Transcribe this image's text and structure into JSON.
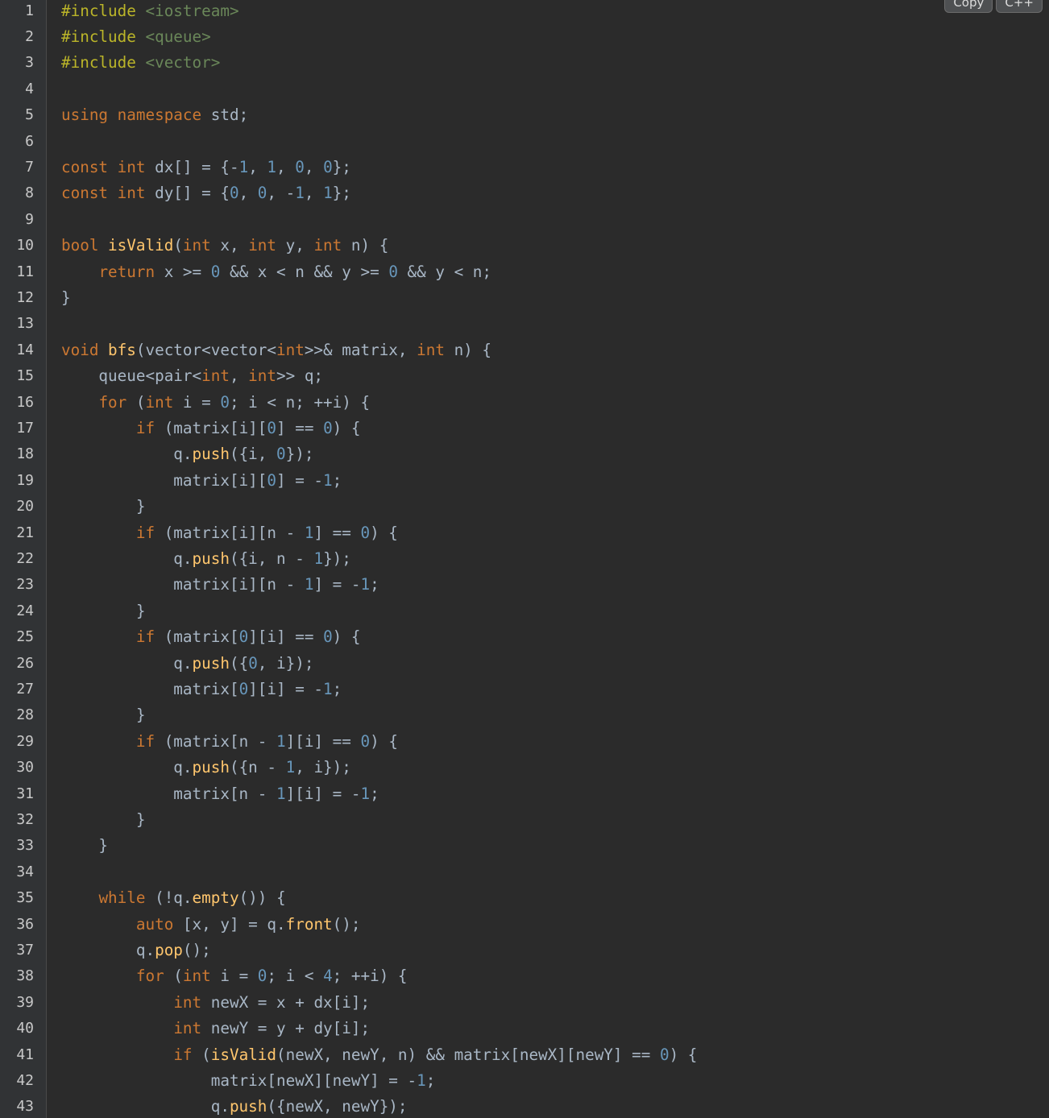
{
  "toolbar": {
    "copy_label": "Copy",
    "language_label": "C++"
  },
  "colors": {
    "background": "#2b2b2b",
    "gutter": "#313335",
    "keyword": "#cc7832",
    "number": "#6897bb",
    "string": "#6a8759",
    "function": "#ffc66d",
    "plain": "#a9b7c6",
    "preprocessor": "#bbb529"
  },
  "lines": [
    {
      "n": "1",
      "tokens": [
        [
          "pp",
          "#include "
        ],
        [
          "hdr",
          "<iostream>"
        ]
      ]
    },
    {
      "n": "2",
      "tokens": [
        [
          "pp",
          "#include "
        ],
        [
          "hdr",
          "<queue>"
        ]
      ]
    },
    {
      "n": "3",
      "tokens": [
        [
          "pp",
          "#include "
        ],
        [
          "hdr",
          "<vector>"
        ]
      ]
    },
    {
      "n": "4",
      "tokens": []
    },
    {
      "n": "5",
      "tokens": [
        [
          "kw",
          "using"
        ],
        [
          "plain",
          " "
        ],
        [
          "kw",
          "namespace"
        ],
        [
          "plain",
          " std;"
        ]
      ]
    },
    {
      "n": "6",
      "tokens": []
    },
    {
      "n": "7",
      "tokens": [
        [
          "kw",
          "const"
        ],
        [
          "plain",
          " "
        ],
        [
          "kw",
          "int"
        ],
        [
          "plain",
          " dx[] = {-"
        ],
        [
          "num",
          "1"
        ],
        [
          "plain",
          ", "
        ],
        [
          "num",
          "1"
        ],
        [
          "plain",
          ", "
        ],
        [
          "num",
          "0"
        ],
        [
          "plain",
          ", "
        ],
        [
          "num",
          "0"
        ],
        [
          "plain",
          "};"
        ]
      ]
    },
    {
      "n": "8",
      "tokens": [
        [
          "kw",
          "const"
        ],
        [
          "plain",
          " "
        ],
        [
          "kw",
          "int"
        ],
        [
          "plain",
          " dy[] = {"
        ],
        [
          "num",
          "0"
        ],
        [
          "plain",
          ", "
        ],
        [
          "num",
          "0"
        ],
        [
          "plain",
          ", -"
        ],
        [
          "num",
          "1"
        ],
        [
          "plain",
          ", "
        ],
        [
          "num",
          "1"
        ],
        [
          "plain",
          "};"
        ]
      ]
    },
    {
      "n": "9",
      "tokens": []
    },
    {
      "n": "10",
      "tokens": [
        [
          "kw",
          "bool"
        ],
        [
          "plain",
          " "
        ],
        [
          "fn",
          "isValid"
        ],
        [
          "plain",
          "("
        ],
        [
          "kw",
          "int"
        ],
        [
          "plain",
          " x, "
        ],
        [
          "kw",
          "int"
        ],
        [
          "plain",
          " y, "
        ],
        [
          "kw",
          "int"
        ],
        [
          "plain",
          " n) {"
        ]
      ]
    },
    {
      "n": "11",
      "tokens": [
        [
          "plain",
          "    "
        ],
        [
          "kw",
          "return"
        ],
        [
          "plain",
          " x >= "
        ],
        [
          "num",
          "0"
        ],
        [
          "plain",
          " && x < n && y >= "
        ],
        [
          "num",
          "0"
        ],
        [
          "plain",
          " && y < n;"
        ]
      ]
    },
    {
      "n": "12",
      "tokens": [
        [
          "plain",
          "}"
        ]
      ]
    },
    {
      "n": "13",
      "tokens": []
    },
    {
      "n": "14",
      "tokens": [
        [
          "kw",
          "void"
        ],
        [
          "plain",
          " "
        ],
        [
          "fn",
          "bfs"
        ],
        [
          "plain",
          "(vector<vector<"
        ],
        [
          "kw",
          "int"
        ],
        [
          "plain",
          ">>& matrix, "
        ],
        [
          "kw",
          "int"
        ],
        [
          "plain",
          " n) {"
        ]
      ]
    },
    {
      "n": "15",
      "tokens": [
        [
          "plain",
          "    queue<pair<"
        ],
        [
          "kw",
          "int"
        ],
        [
          "plain",
          ", "
        ],
        [
          "kw",
          "int"
        ],
        [
          "plain",
          ">> q;"
        ]
      ]
    },
    {
      "n": "16",
      "tokens": [
        [
          "plain",
          "    "
        ],
        [
          "kw",
          "for"
        ],
        [
          "plain",
          " ("
        ],
        [
          "kw",
          "int"
        ],
        [
          "plain",
          " i = "
        ],
        [
          "num",
          "0"
        ],
        [
          "plain",
          "; i < n; ++i) {"
        ]
      ]
    },
    {
      "n": "17",
      "tokens": [
        [
          "plain",
          "        "
        ],
        [
          "kw",
          "if"
        ],
        [
          "plain",
          " (matrix[i]["
        ],
        [
          "num",
          "0"
        ],
        [
          "plain",
          "] == "
        ],
        [
          "num",
          "0"
        ],
        [
          "plain",
          ") {"
        ]
      ]
    },
    {
      "n": "18",
      "tokens": [
        [
          "plain",
          "            q."
        ],
        [
          "fn",
          "push"
        ],
        [
          "plain",
          "({i, "
        ],
        [
          "num",
          "0"
        ],
        [
          "plain",
          "});"
        ]
      ]
    },
    {
      "n": "19",
      "tokens": [
        [
          "plain",
          "            matrix[i]["
        ],
        [
          "num",
          "0"
        ],
        [
          "plain",
          "] = -"
        ],
        [
          "num",
          "1"
        ],
        [
          "plain",
          ";"
        ]
      ]
    },
    {
      "n": "20",
      "tokens": [
        [
          "plain",
          "        }"
        ]
      ]
    },
    {
      "n": "21",
      "tokens": [
        [
          "plain",
          "        "
        ],
        [
          "kw",
          "if"
        ],
        [
          "plain",
          " (matrix[i][n - "
        ],
        [
          "num",
          "1"
        ],
        [
          "plain",
          "] == "
        ],
        [
          "num",
          "0"
        ],
        [
          "plain",
          ") {"
        ]
      ]
    },
    {
      "n": "22",
      "tokens": [
        [
          "plain",
          "            q."
        ],
        [
          "fn",
          "push"
        ],
        [
          "plain",
          "({i, n - "
        ],
        [
          "num",
          "1"
        ],
        [
          "plain",
          "});"
        ]
      ]
    },
    {
      "n": "23",
      "tokens": [
        [
          "plain",
          "            matrix[i][n - "
        ],
        [
          "num",
          "1"
        ],
        [
          "plain",
          "] = -"
        ],
        [
          "num",
          "1"
        ],
        [
          "plain",
          ";"
        ]
      ]
    },
    {
      "n": "24",
      "tokens": [
        [
          "plain",
          "        }"
        ]
      ]
    },
    {
      "n": "25",
      "tokens": [
        [
          "plain",
          "        "
        ],
        [
          "kw",
          "if"
        ],
        [
          "plain",
          " (matrix["
        ],
        [
          "num",
          "0"
        ],
        [
          "plain",
          "][i] == "
        ],
        [
          "num",
          "0"
        ],
        [
          "plain",
          ") {"
        ]
      ]
    },
    {
      "n": "26",
      "tokens": [
        [
          "plain",
          "            q."
        ],
        [
          "fn",
          "push"
        ],
        [
          "plain",
          "({"
        ],
        [
          "num",
          "0"
        ],
        [
          "plain",
          ", i});"
        ]
      ]
    },
    {
      "n": "27",
      "tokens": [
        [
          "plain",
          "            matrix["
        ],
        [
          "num",
          "0"
        ],
        [
          "plain",
          "][i] = -"
        ],
        [
          "num",
          "1"
        ],
        [
          "plain",
          ";"
        ]
      ]
    },
    {
      "n": "28",
      "tokens": [
        [
          "plain",
          "        }"
        ]
      ]
    },
    {
      "n": "29",
      "tokens": [
        [
          "plain",
          "        "
        ],
        [
          "kw",
          "if"
        ],
        [
          "plain",
          " (matrix[n - "
        ],
        [
          "num",
          "1"
        ],
        [
          "plain",
          "][i] == "
        ],
        [
          "num",
          "0"
        ],
        [
          "plain",
          ") {"
        ]
      ]
    },
    {
      "n": "30",
      "tokens": [
        [
          "plain",
          "            q."
        ],
        [
          "fn",
          "push"
        ],
        [
          "plain",
          "({n - "
        ],
        [
          "num",
          "1"
        ],
        [
          "plain",
          ", i});"
        ]
      ]
    },
    {
      "n": "31",
      "tokens": [
        [
          "plain",
          "            matrix[n - "
        ],
        [
          "num",
          "1"
        ],
        [
          "plain",
          "][i] = -"
        ],
        [
          "num",
          "1"
        ],
        [
          "plain",
          ";"
        ]
      ]
    },
    {
      "n": "32",
      "tokens": [
        [
          "plain",
          "        }"
        ]
      ]
    },
    {
      "n": "33",
      "tokens": [
        [
          "plain",
          "    }"
        ]
      ]
    },
    {
      "n": "34",
      "tokens": []
    },
    {
      "n": "35",
      "tokens": [
        [
          "plain",
          "    "
        ],
        [
          "kw",
          "while"
        ],
        [
          "plain",
          " (!q."
        ],
        [
          "fn",
          "empty"
        ],
        [
          "plain",
          "()) {"
        ]
      ]
    },
    {
      "n": "36",
      "tokens": [
        [
          "plain",
          "        "
        ],
        [
          "kw",
          "auto"
        ],
        [
          "plain",
          " [x, y] = q."
        ],
        [
          "fn",
          "front"
        ],
        [
          "plain",
          "();"
        ]
      ]
    },
    {
      "n": "37",
      "tokens": [
        [
          "plain",
          "        q."
        ],
        [
          "fn",
          "pop"
        ],
        [
          "plain",
          "();"
        ]
      ]
    },
    {
      "n": "38",
      "tokens": [
        [
          "plain",
          "        "
        ],
        [
          "kw",
          "for"
        ],
        [
          "plain",
          " ("
        ],
        [
          "kw",
          "int"
        ],
        [
          "plain",
          " i = "
        ],
        [
          "num",
          "0"
        ],
        [
          "plain",
          "; i < "
        ],
        [
          "num",
          "4"
        ],
        [
          "plain",
          "; ++i) {"
        ]
      ]
    },
    {
      "n": "39",
      "tokens": [
        [
          "plain",
          "            "
        ],
        [
          "kw",
          "int"
        ],
        [
          "plain",
          " newX = x + dx[i];"
        ]
      ]
    },
    {
      "n": "40",
      "tokens": [
        [
          "plain",
          "            "
        ],
        [
          "kw",
          "int"
        ],
        [
          "plain",
          " newY = y + dy[i];"
        ]
      ]
    },
    {
      "n": "41",
      "tokens": [
        [
          "plain",
          "            "
        ],
        [
          "kw",
          "if"
        ],
        [
          "plain",
          " ("
        ],
        [
          "fn",
          "isValid"
        ],
        [
          "plain",
          "(newX, newY, n) && matrix[newX][newY] == "
        ],
        [
          "num",
          "0"
        ],
        [
          "plain",
          ") {"
        ]
      ]
    },
    {
      "n": "42",
      "tokens": [
        [
          "plain",
          "                matrix[newX][newY] = -"
        ],
        [
          "num",
          "1"
        ],
        [
          "plain",
          ";"
        ]
      ]
    },
    {
      "n": "43",
      "tokens": [
        [
          "plain",
          "                q."
        ],
        [
          "fn",
          "push"
        ],
        [
          "plain",
          "({newX, newY});"
        ]
      ]
    }
  ]
}
